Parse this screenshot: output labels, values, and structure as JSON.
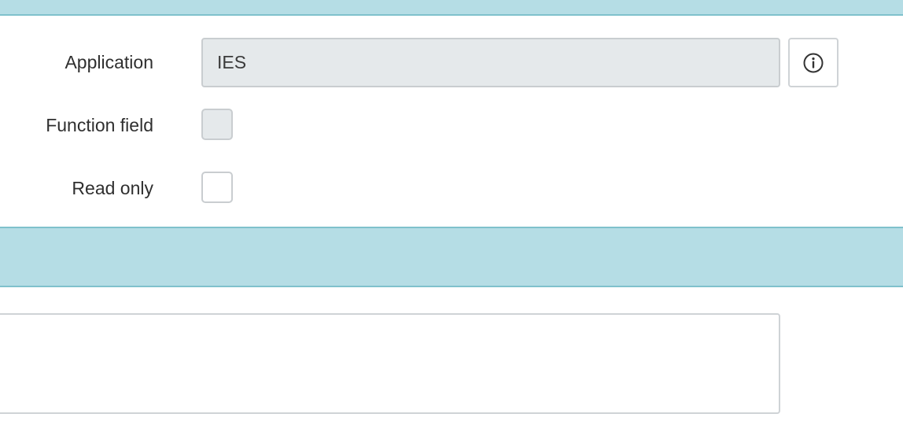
{
  "form": {
    "application": {
      "label": "Application",
      "value": "IES"
    },
    "function_field": {
      "label": "Function field",
      "checked": false
    },
    "read_only": {
      "label": "Read only",
      "checked": false
    }
  },
  "icons": {
    "info": "info-circle-icon"
  },
  "colors": {
    "section_band": "#b5dde5",
    "section_band_border": "#7fc1cc",
    "readonly_field_bg": "#e5e9eb"
  }
}
